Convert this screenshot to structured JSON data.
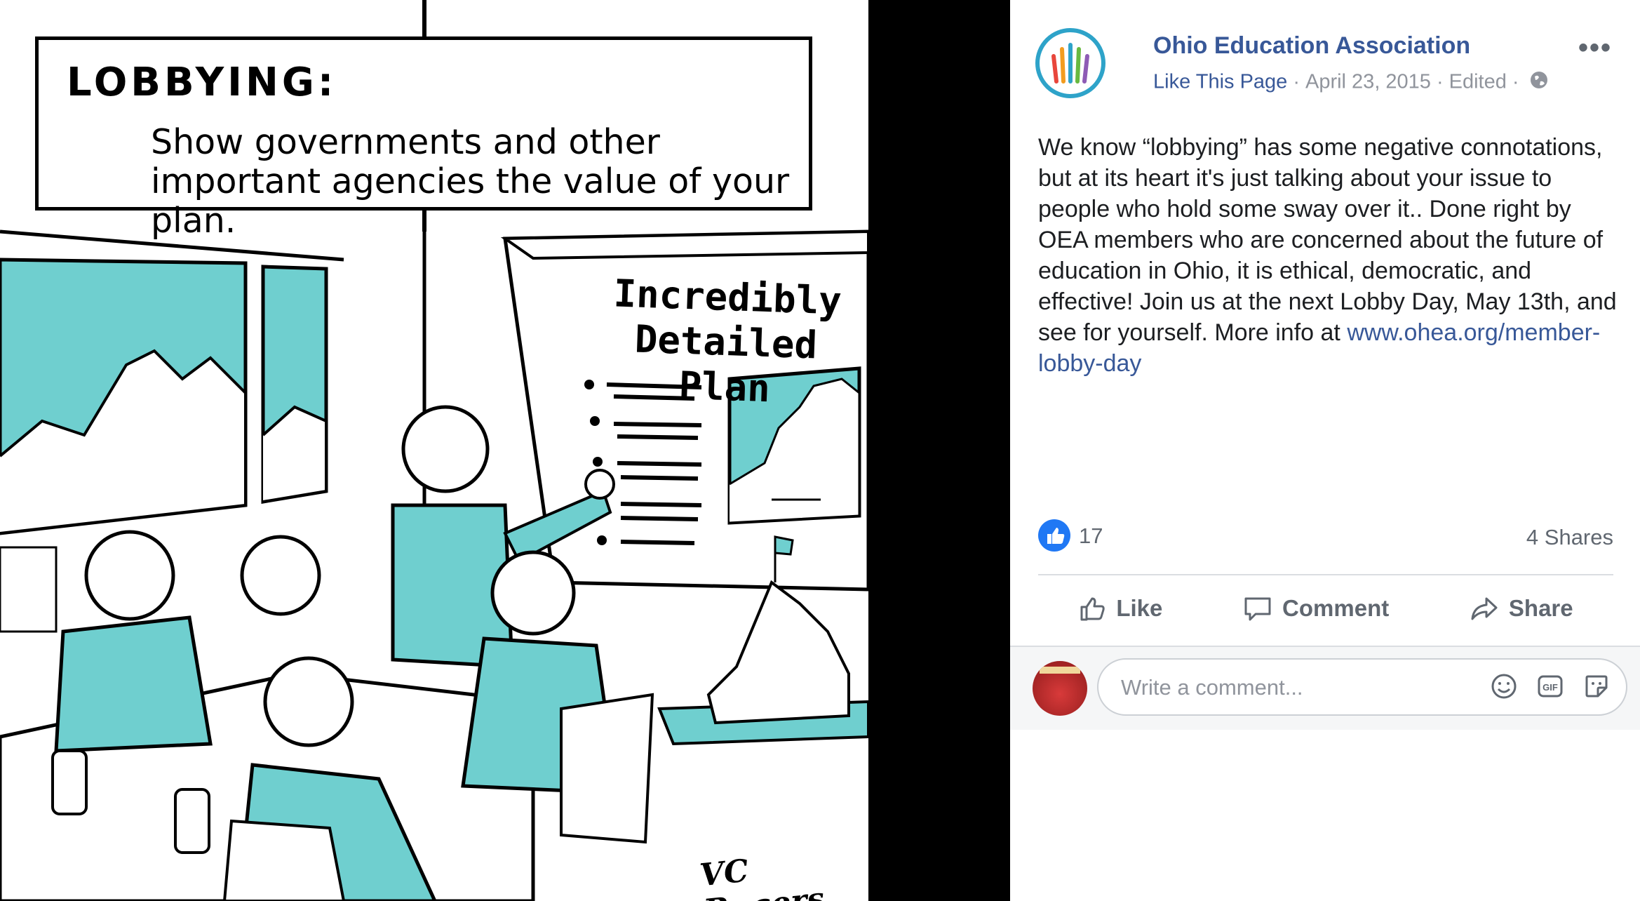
{
  "cartoon": {
    "caption_title": "LOBBYING:",
    "caption_body": "Show governments and other important agencies the value of your plan.",
    "plan_title": "Incredibly Detailed Plan",
    "signature": "VC Rogers",
    "accent_color": "#6fcfcf"
  },
  "post": {
    "page_name": "Ohio Education Association",
    "like_page_label": "Like This Page",
    "date": "April 23, 2015",
    "edited_label": "Edited",
    "more_icon": "more-options-icon",
    "text": "We know “lobbying” has some negative connotations, but at its heart it's just talking about your issue to people who hold some sway over it.. Done right by OEA members who are concerned about the future of education in Ohio, it is ethical, democratic, and effective! Join us at the next Lobby Day, May 13th, and see for yourself. More info at",
    "link": "www.ohea.org/member-lobby-day",
    "like_count": "17",
    "shares": "4 Shares",
    "link_color": "#385898"
  },
  "actions": {
    "like": "Like",
    "comment": "Comment",
    "share": "Share"
  },
  "comment_box": {
    "placeholder": "Write a comment...",
    "icons": [
      "emoji-icon",
      "gif-icon",
      "sticker-icon"
    ]
  }
}
